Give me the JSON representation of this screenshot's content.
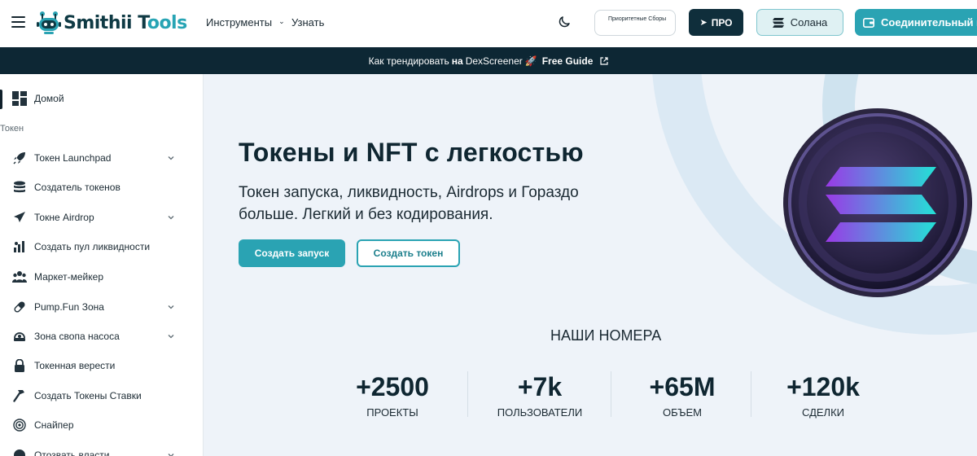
{
  "header": {
    "logo": {
      "text_main": "Smithii T",
      "text_accent": "ools"
    },
    "nav": {
      "tools": "Инструменты",
      "learn": "Узнать"
    },
    "priority_label": "Приоритетные Сборы",
    "pro_label": "ПРО",
    "network_label": "Солана",
    "connect_label": "Соединительный кошелек"
  },
  "banner": {
    "prefix": "Как трендировать",
    "on": "на",
    "name": "DexScreener",
    "rocket": "🚀",
    "guide": "Free Guide"
  },
  "sidebar": {
    "section_token": "Токен",
    "items": [
      {
        "label": "Домой",
        "icon": "dashboard-icon",
        "has_children": false
      },
      {
        "label": "Токен Launchpad",
        "icon": "rocket-icon",
        "has_children": true
      },
      {
        "label": "Создатель токенов",
        "icon": "coins-stack-icon",
        "has_children": false
      },
      {
        "label": "Токне Airdrop",
        "icon": "paper-plane-icon",
        "has_children": true
      },
      {
        "label": "Создать пул ликвидности",
        "icon": "bar-chart-icon",
        "has_children": false
      },
      {
        "label": "Маркет-мейкер",
        "icon": "users-icon",
        "has_children": false
      },
      {
        "label": "Pump.Fun Зона",
        "icon": "pill-icon",
        "has_children": true
      },
      {
        "label": "Зона свопа насоса",
        "icon": "swap-zone-icon",
        "has_children": true
      },
      {
        "label": "Токенная верести",
        "icon": "lock-icon",
        "has_children": false
      },
      {
        "label": "Создать Токены Ставки",
        "icon": "hammer-icon",
        "has_children": false
      },
      {
        "label": "Снайпер",
        "icon": "target-icon",
        "has_children": false
      },
      {
        "label": "Отозвать власти",
        "icon": "revoke-icon",
        "has_children": true
      }
    ]
  },
  "hero": {
    "title": "Токены и NFT с легкостью",
    "subtitle": "Токен запуска, ликвидность, Airdrops и Гораздо больше. Легкий и без кодирования.",
    "primary_button": "Создать запуск",
    "secondary_button": "Создать токен"
  },
  "stats": {
    "title": "НАШИ НОМЕРА",
    "items": [
      {
        "value": "+2500",
        "label": "ПРОЕКТЫ"
      },
      {
        "value": "+7k",
        "label": "ПОЛЬЗОВАТЕЛИ"
      },
      {
        "value": "+65M",
        "label": "ОБЪЕМ"
      },
      {
        "value": "+120k",
        "label": "СДЕЛКИ"
      }
    ]
  },
  "colors": {
    "accent": "#2aa3b3",
    "dark": "#0f2e3b",
    "banner_bg": "#0d2734",
    "main_bg": "#eef3f9",
    "text": "#1b2a33"
  }
}
